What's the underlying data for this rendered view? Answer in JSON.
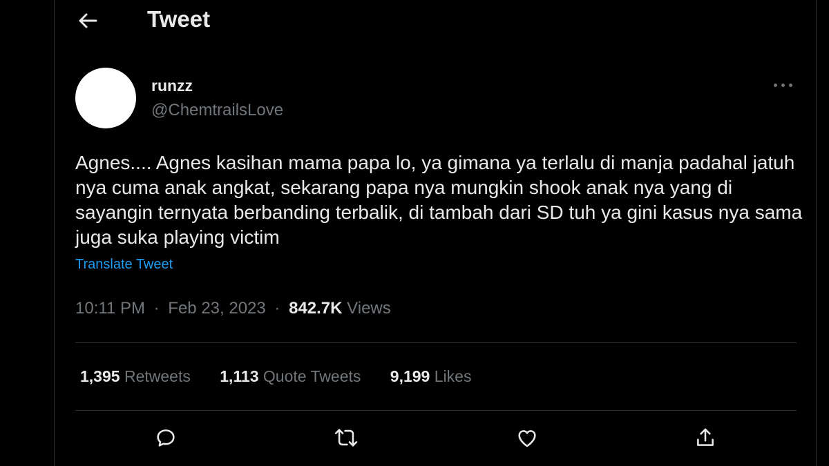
{
  "header": {
    "title": "Tweet",
    "back_icon": "arrow-left-icon"
  },
  "author": {
    "display_name": "runzz",
    "handle": "@ChemtrailsLove"
  },
  "tweet": {
    "text": "Agnes.... Agnes kasihan mama papa lo, ya gimana ya terlalu di manja padahal jatuh nya cuma anak angkat, sekarang papa nya mungkin shook anak nya yang di sayangin ternyata berbanding terbalik, di tambah dari SD tuh ya gini kasus nya sama juga suka playing victim",
    "translate_label": "Translate Tweet",
    "time": "10:11 PM",
    "date": "Feb 23, 2023",
    "separator": "·",
    "views_count": "842.7K",
    "views_label": "Views"
  },
  "stats": {
    "retweets_count": "1,395",
    "retweets_label": "Retweets",
    "quotes_count": "1,113",
    "quotes_label": "Quote Tweets",
    "likes_count": "9,199",
    "likes_label": "Likes"
  },
  "actions": [
    "reply-icon",
    "retweet-icon",
    "like-icon",
    "share-icon"
  ],
  "colors": {
    "background": "#000000",
    "text": "#e7e9ea",
    "secondary": "#71767b",
    "link": "#1d9bf0",
    "divider": "#2f3336"
  }
}
